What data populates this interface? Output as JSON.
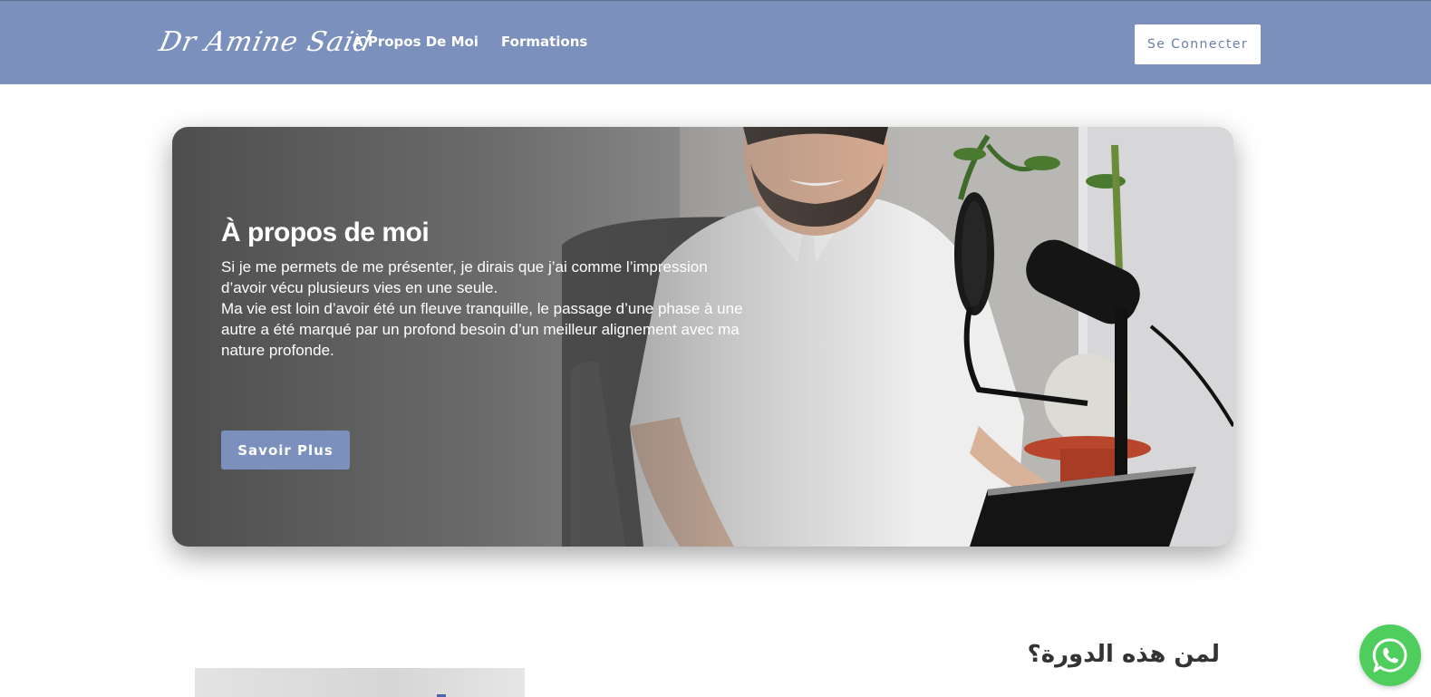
{
  "header": {
    "logo_text": "Dr Amine Said",
    "nav": [
      {
        "label": "À Propos De Moi"
      },
      {
        "label": "Formations"
      }
    ],
    "login_label": "Se Connecter"
  },
  "hero": {
    "title": "À propos de moi",
    "paragraph_1": "Si je me permets de me présenter, je dirais que j’ai comme l’impression d’avoir vécu plusieurs vies en une seule.",
    "paragraph_2": "Ma vie est loin d’avoir été un fleuve tranquille, le passage d’une phase à une autre a été marqué par un profond besoin d’un meilleur alignement avec ma nature profonde.",
    "button_label": "Savoir Plus"
  },
  "section": {
    "heading": "لمن هذه الدورة؟"
  },
  "icons": {
    "whatsapp": "whatsapp-icon"
  },
  "colors": {
    "brand": "#7b90bd",
    "whatsapp": "#4fce5d"
  }
}
